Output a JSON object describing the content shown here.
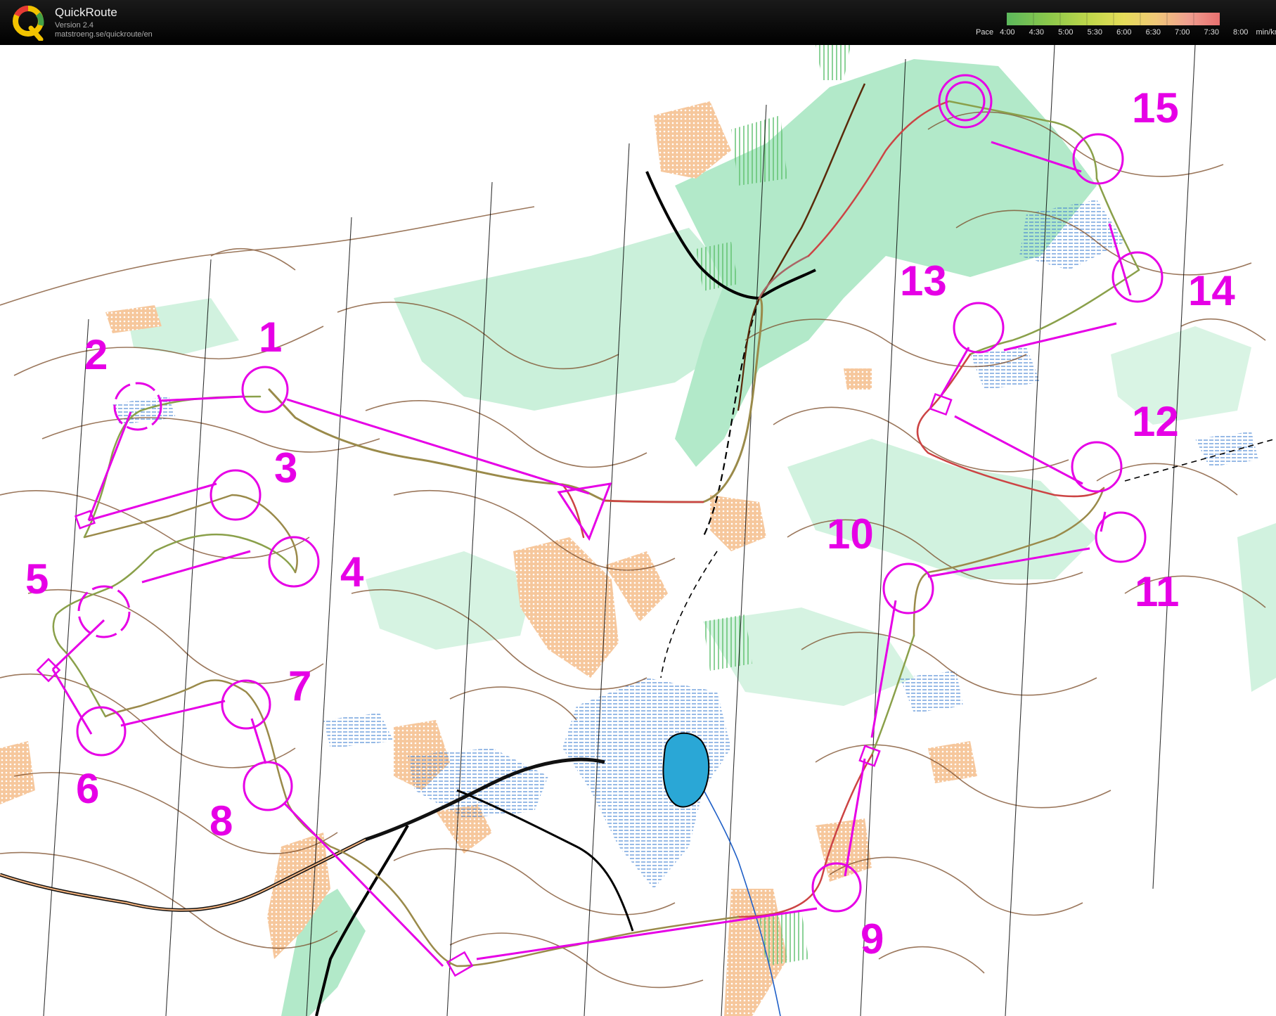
{
  "app": {
    "title": "QuickRoute",
    "version": "Version 2.4",
    "url": "matstroeng.se/quickroute/en"
  },
  "pace_scale": {
    "label": "Pace",
    "ticks": [
      "4:00",
      "4:30",
      "5:00",
      "5:30",
      "6:00",
      "6:30",
      "7:00",
      "7:30",
      "8:00"
    ],
    "unit": "min/km",
    "colors": [
      "#5cb85c",
      "#8cc84b",
      "#c3d84b",
      "#e6dc5a",
      "#f0c878",
      "#f0a090",
      "#e87070"
    ]
  },
  "colors": {
    "course": "#e600e6",
    "contour": "#7a4a25",
    "forest_green": "#9fe3b8",
    "open_land": "#f3b27d",
    "water": "#2aa7d6",
    "route": "#9a8a4a"
  },
  "controls": [
    "1",
    "2",
    "3",
    "4",
    "5",
    "6",
    "7",
    "8",
    "9",
    "10",
    "11",
    "12",
    "13",
    "14",
    "15"
  ]
}
